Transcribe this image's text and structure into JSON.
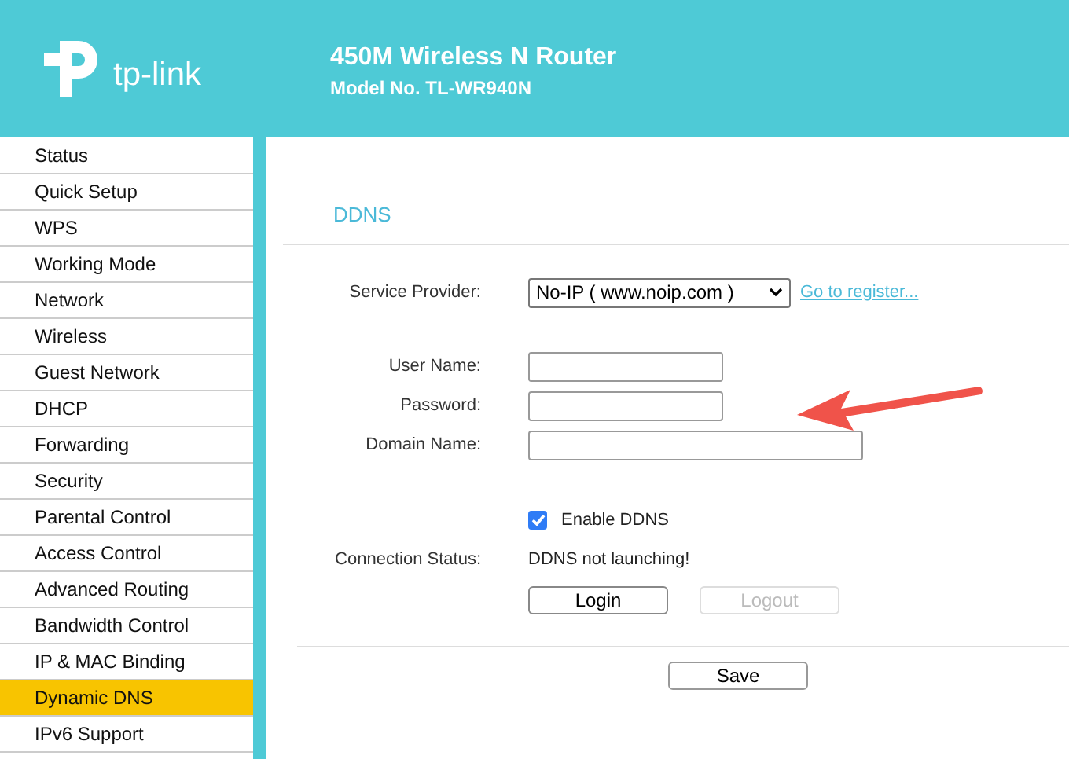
{
  "header": {
    "logo_text": "tp-link",
    "title": "450M Wireless N Router",
    "model": "Model No. TL-WR940N"
  },
  "sidebar": {
    "items": [
      {
        "label": "Status",
        "selected": false
      },
      {
        "label": "Quick Setup",
        "selected": false
      },
      {
        "label": "WPS",
        "selected": false
      },
      {
        "label": "Working Mode",
        "selected": false
      },
      {
        "label": "Network",
        "selected": false
      },
      {
        "label": "Wireless",
        "selected": false
      },
      {
        "label": "Guest Network",
        "selected": false
      },
      {
        "label": "DHCP",
        "selected": false
      },
      {
        "label": "Forwarding",
        "selected": false
      },
      {
        "label": "Security",
        "selected": false
      },
      {
        "label": "Parental Control",
        "selected": false
      },
      {
        "label": "Access Control",
        "selected": false
      },
      {
        "label": "Advanced Routing",
        "selected": false
      },
      {
        "label": "Bandwidth Control",
        "selected": false
      },
      {
        "label": "IP & MAC Binding",
        "selected": false
      },
      {
        "label": "Dynamic DNS",
        "selected": true
      },
      {
        "label": "IPv6 Support",
        "selected": false
      }
    ]
  },
  "content": {
    "title": "DDNS",
    "service_provider": {
      "label": "Service Provider:",
      "value": "No-IP ( www.noip.com )",
      "link": "Go to register..."
    },
    "fields": [
      {
        "label": "User Name:"
      },
      {
        "label": "Password:"
      },
      {
        "label": "Domain Name:"
      }
    ],
    "enable_ddns": {
      "label": "Enable DDNS",
      "checked": true
    },
    "connection_status": {
      "label": "Connection Status:",
      "value": "DDNS not launching!"
    },
    "buttons": [
      {
        "label": "Login",
        "disabled": false
      },
      {
        "label": "Logout",
        "disabled": true
      }
    ],
    "save": "Save"
  }
}
